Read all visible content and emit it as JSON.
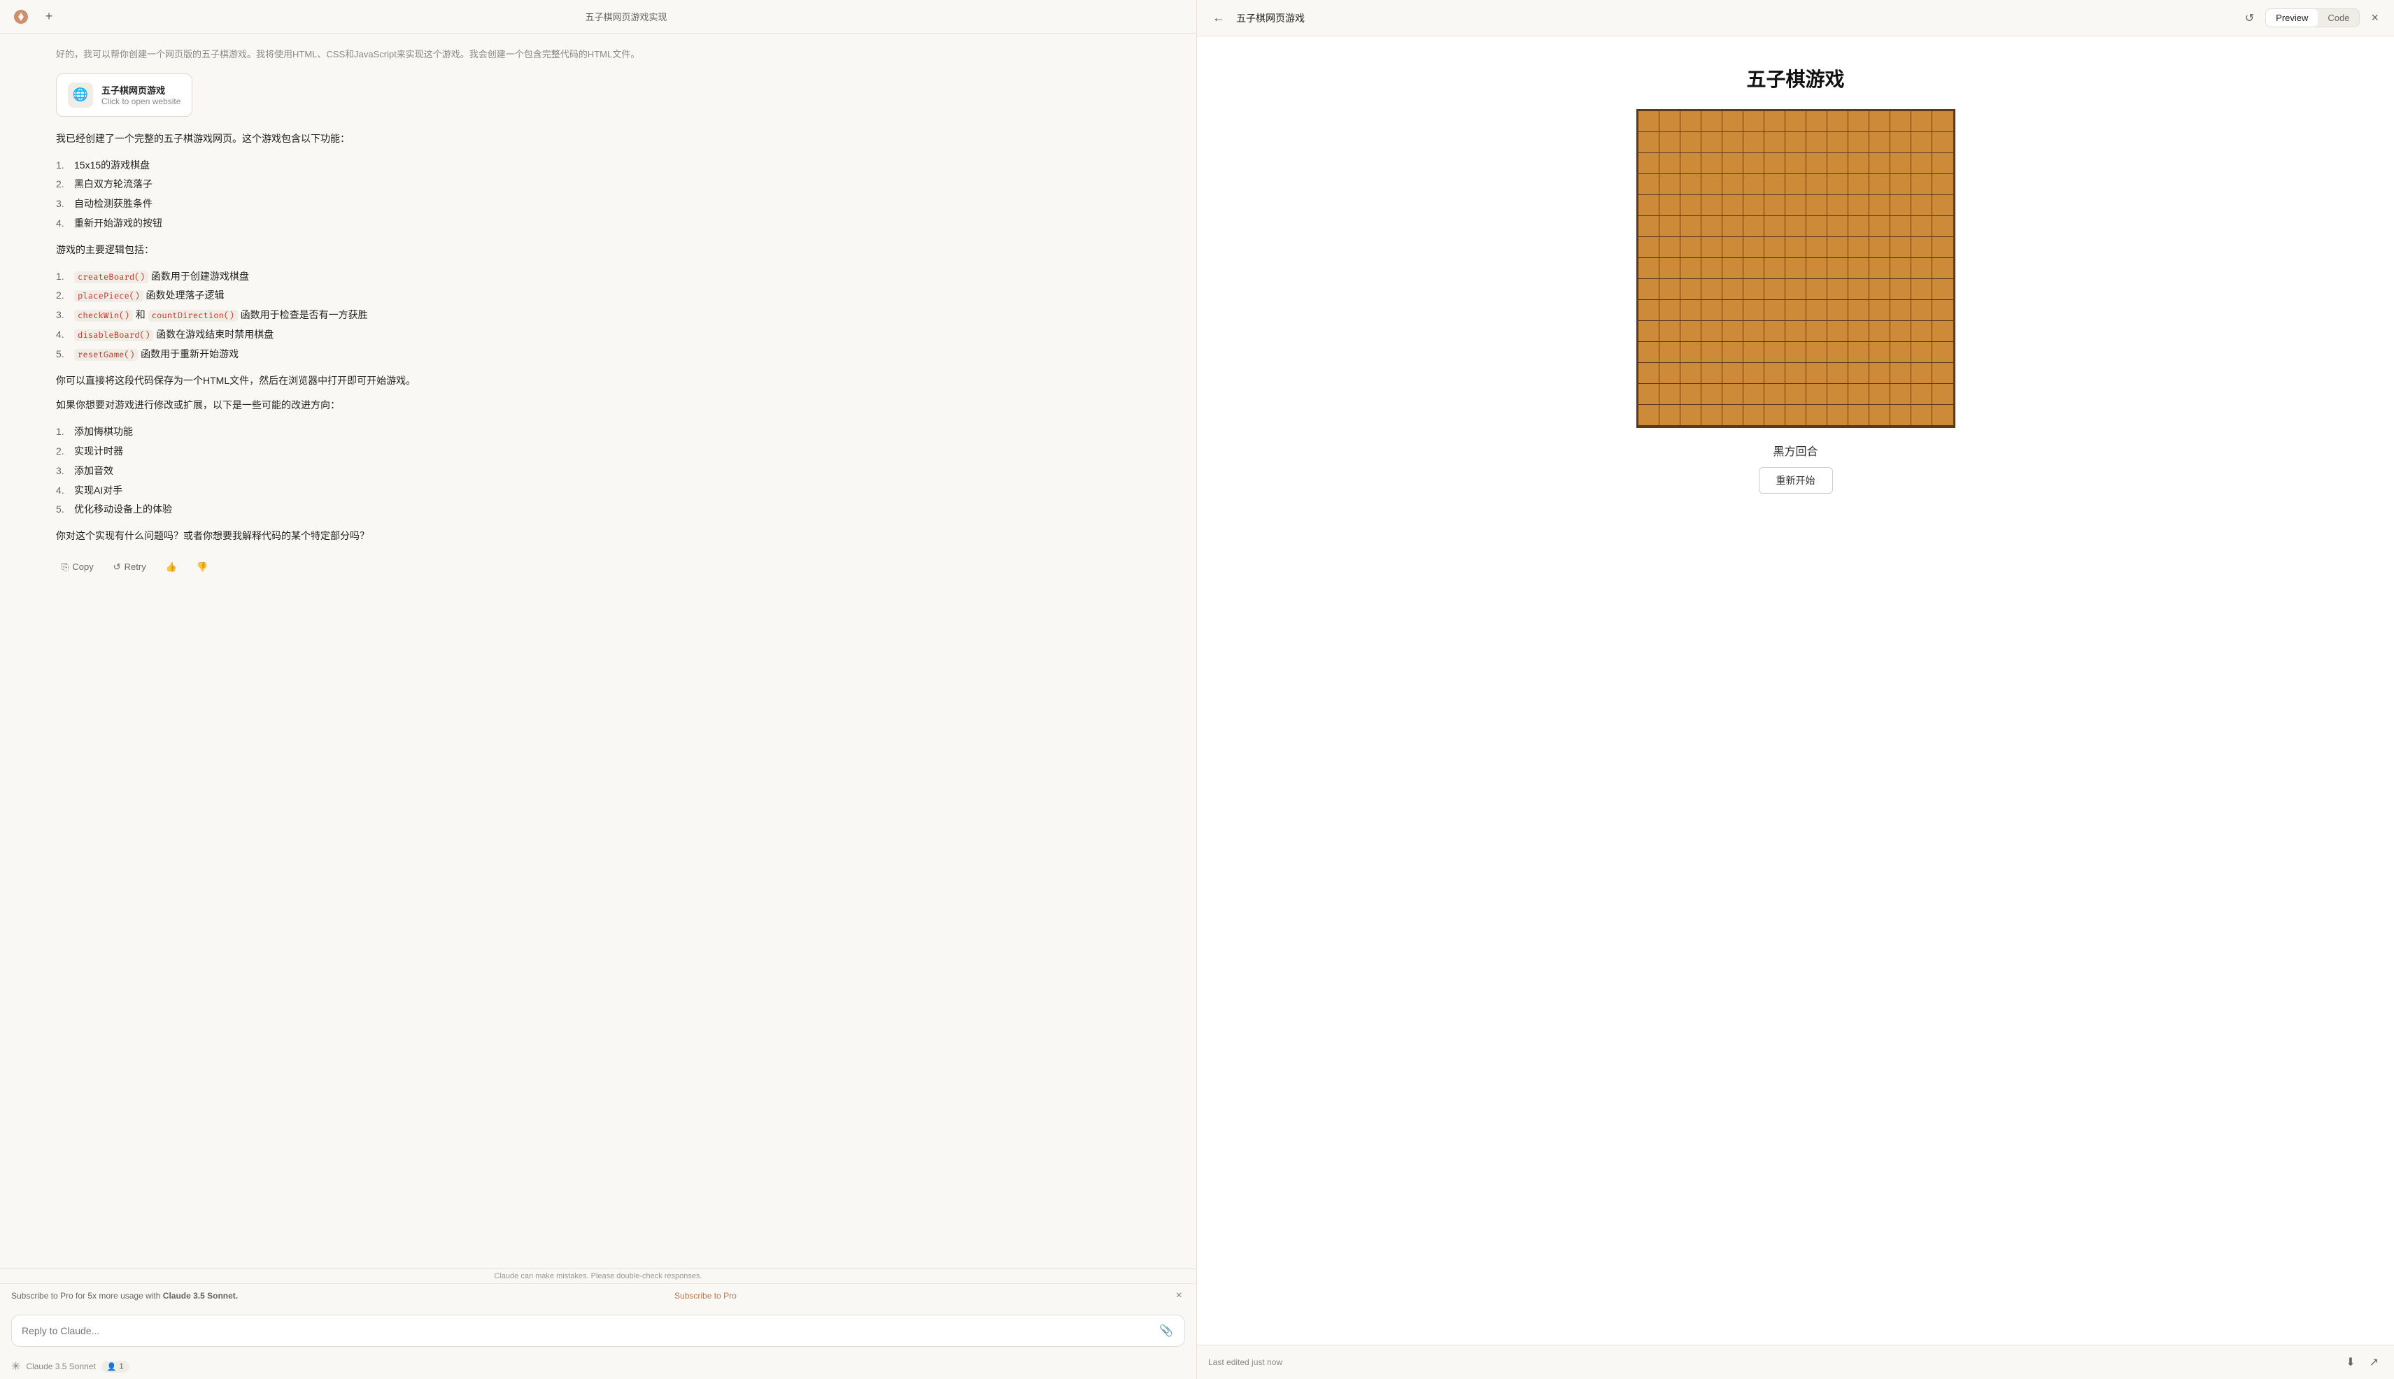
{
  "app": {
    "title": "五子棋网页游戏实现"
  },
  "topbar": {
    "add_label": "+"
  },
  "context_text": "好的，我可以帮你创建一个网页版的五子棋游戏。我将使用HTML、CSS和JavaScript来实现这个游戏。我会创建一个包含完整代码的HTML文件。",
  "website_card": {
    "title": "五子棋网页游戏",
    "subtitle": "Click to open website"
  },
  "message": {
    "intro": "我已经创建了一个完整的五子棋游戏网页。这个游戏包含以下功能：",
    "features": [
      {
        "num": "1.",
        "text": "15x15的游戏棋盘"
      },
      {
        "num": "2.",
        "text": "黑白双方轮流落子"
      },
      {
        "num": "3.",
        "text": "自动检测获胜条件"
      },
      {
        "num": "4.",
        "text": "重新开始游戏的按钮"
      }
    ],
    "logic_intro": "游戏的主要逻辑包括：",
    "logic_items": [
      {
        "num": "1.",
        "code": "createBoard()",
        "text": " 函数用于创建游戏棋盘"
      },
      {
        "num": "2.",
        "code": "placePiece()",
        "text": " 函数处理落子逻辑"
      },
      {
        "num": "3.",
        "code": "checkWin()",
        "text": " 和 ",
        "code2": "countDirection()",
        "text2": " 函数用于检查是否有一方获胜"
      },
      {
        "num": "4.",
        "code": "disableBoard()",
        "text": " 函数在游戏结束时禁用棋盘"
      },
      {
        "num": "5.",
        "code": "resetGame()",
        "text": " 函数用于重新开始游戏"
      }
    ],
    "save_note": "你可以直接将这段代码保存为一个HTML文件，然后在浏览器中打开即可开始游戏。",
    "improve_note": "如果你想要对游戏进行修改或扩展，以下是一些可能的改进方向：",
    "improvements": [
      {
        "num": "1.",
        "text": "添加悔棋功能"
      },
      {
        "num": "2.",
        "text": "实现计时器"
      },
      {
        "num": "3.",
        "text": "添加音效"
      },
      {
        "num": "4.",
        "text": "实现AI对手"
      },
      {
        "num": "5.",
        "text": "优化移动设备上的体验"
      }
    ],
    "question": "你对这个实现有什么问题吗？或者你想要我解释代码的某个特定部分吗？"
  },
  "action_bar": {
    "copy_label": "Copy",
    "retry_label": "Retry"
  },
  "error_notice": "Claude can make mistakes. Please double-check responses.",
  "subscribe_banner": {
    "text": "Subscribe to Pro for 5x more usage with ",
    "bold_text": "Claude 3.5 Sonnet.",
    "link_label": "Subscribe to Pro"
  },
  "input": {
    "placeholder": "Reply to Claude..."
  },
  "model_info": {
    "name": "Claude 3.5 Sonnet",
    "badge": "1"
  },
  "preview": {
    "title": "五子棋网页游戏",
    "tab_preview": "Preview",
    "tab_code": "Code",
    "game_title": "五子棋游戏",
    "game_status": "黑方回合",
    "restart_label": "重新开始",
    "last_edited": "Last edited just now"
  }
}
